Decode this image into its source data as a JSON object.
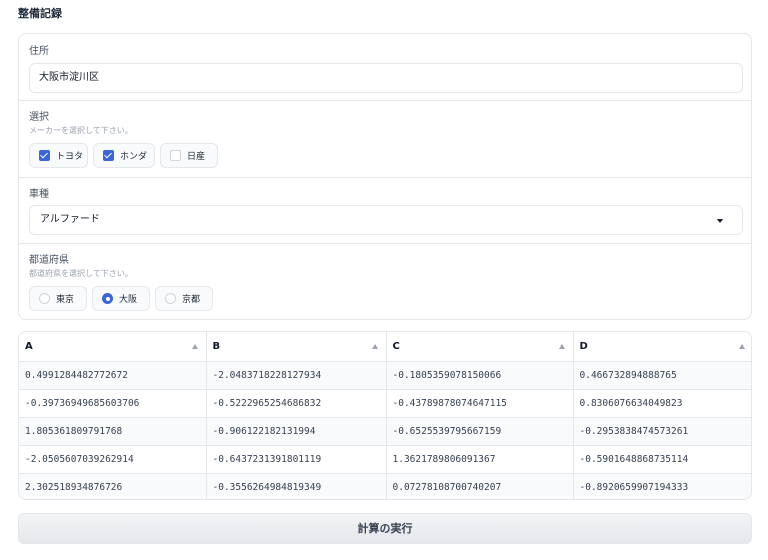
{
  "page": {
    "title": "整備記録"
  },
  "form": {
    "address": {
      "label": "住所",
      "value": "大阪市淀川区"
    },
    "selection": {
      "label": "選択",
      "info": "メーカーを選択して下さい。",
      "options": [
        {
          "label": "トヨタ",
          "checked": true
        },
        {
          "label": "ホンダ",
          "checked": true
        },
        {
          "label": "日産",
          "checked": false
        }
      ]
    },
    "vehicle": {
      "label": "車種",
      "value": "アルファード",
      "icon": "chevron-down-icon"
    },
    "prefecture": {
      "label": "都道府県",
      "info": "都道府県を選択して下さい。",
      "options": [
        {
          "label": "東京",
          "selected": false
        },
        {
          "label": "大阪",
          "selected": true
        },
        {
          "label": "京都",
          "selected": false
        }
      ]
    }
  },
  "table": {
    "headers": [
      "A",
      "B",
      "C",
      "D"
    ],
    "rows": [
      [
        "0.4991284482772672",
        "-2.0483718228127934",
        "-0.1805359078150066",
        "0.466732894888765"
      ],
      [
        "-0.39736949685603706",
        "-0.5222965254686832",
        "-0.43789878074647115",
        "0.8306076634049823"
      ],
      [
        "1.805361809791768",
        "-0.906122182131994",
        "-0.6525539795667159",
        "-0.2953838474573261"
      ],
      [
        "-2.0505607039262914",
        "-0.6437231391801119",
        "1.3621789806091367",
        "-0.5901648868735114"
      ],
      [
        "2.302518934876726",
        "-0.3556264984819349",
        "0.07278108700740207",
        "-0.8920659907194333"
      ]
    ]
  },
  "actions": {
    "run_label": "計算の実行"
  },
  "colors": {
    "accent": "#3b65d8",
    "border": "#e5e7eb",
    "stripe": "#f9fafb"
  }
}
